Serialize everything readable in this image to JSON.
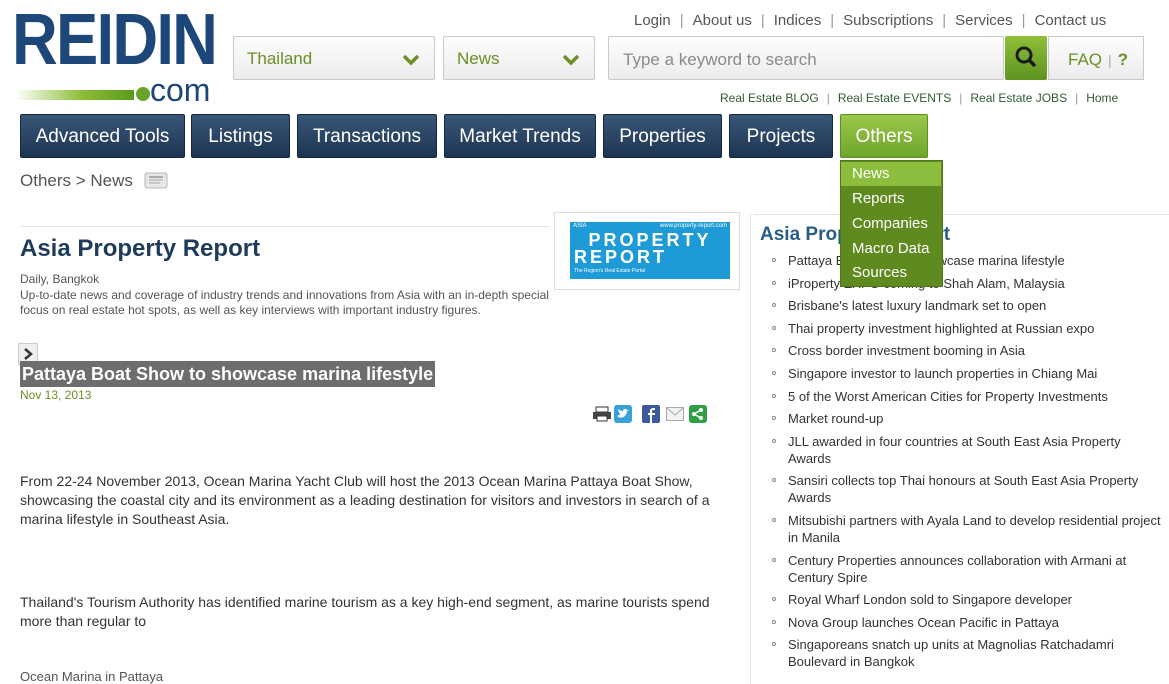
{
  "logo": {
    "word": "REIDIN",
    "suffix": "com"
  },
  "top_links": [
    "Login",
    "About us",
    "Indices",
    "Subscriptions",
    "Services",
    "Contact us"
  ],
  "country_select": {
    "value": "Thailand"
  },
  "section_select": {
    "value": "News"
  },
  "search": {
    "placeholder": "Type a keyword to search"
  },
  "faq": {
    "label": "FAQ",
    "help": "?"
  },
  "small_links": [
    "Real Estate BLOG",
    "Real Estate EVENTS",
    "Real Estate JOBS",
    "Home"
  ],
  "nav": [
    {
      "label": "Advanced Tools"
    },
    {
      "label": "Listings"
    },
    {
      "label": "Transactions"
    },
    {
      "label": "Market Trends"
    },
    {
      "label": "Properties"
    },
    {
      "label": "Projects"
    },
    {
      "label": "Others"
    }
  ],
  "dropdown": [
    "News",
    "Reports",
    "Companies",
    "Macro Data",
    "Sources"
  ],
  "breadcrumb": "Others > News",
  "publication": {
    "title": "Asia Property Report",
    "meta": "Daily, Bangkok",
    "description": "Up-to-date news and coverage of industry trends and innovations from Asia with an in-depth special focus on real estate hot spots, as well as key interviews with important industry figures.",
    "logo_top_left": "ASIA",
    "logo_top_right": "www.property-report.com",
    "logo_line1": "PROPERTY",
    "logo_line2": "REPORT",
    "logo_tagline": "The Region's Real Estate Portal"
  },
  "article": {
    "headline": "Pattaya Boat Show to showcase marina lifestyle",
    "date": "Nov 13, 2013",
    "paragraphs": [
      "From 22-24 November 2013, Ocean Marina Yacht Club will host the 2013 Ocean Marina Pattaya Boat Show, showcasing the coastal city and its environment as a leading destination for visitors and investors in search of a marina lifestyle in Southeast Asia.",
      "Thailand's Tourism Authority has identified marine tourism as a key high-end segment, as marine tourists spend more than regular to",
      "Ocean Marina in Pattaya"
    ]
  },
  "sidebar": {
    "title": "Asia Property Report",
    "items": [
      "Pattaya Boat Show to showcase marina lifestyle",
      "iProperty EXPO coming to Shah Alam, Malaysia",
      "Brisbane's latest luxury landmark set to open",
      "Thai property investment highlighted at Russian expo",
      "Cross border investment booming in Asia",
      "Singapore investor to launch properties in Chiang Mai",
      "5 of the Worst American Cities for Property Investments",
      "Market round-up",
      "JLL awarded in four countries at South East Asia Property Awards",
      "Sansiri collects top Thai honours at South East Asia Property Awards",
      "Mitsubishi partners with Ayala Land to develop residential project in Manila",
      "Century Properties announces collaboration with Armani at Century Spire",
      "Royal Wharf London sold to Singapore developer",
      "Nova Group launches Ocean Pacific in Pattaya",
      "Singaporeans snatch up units at Magnolias Ratchadamri Boulevard in Bangkok"
    ]
  },
  "colors": {
    "brand_blue": "#1d4778",
    "brand_green": "#6da52c",
    "nav_dark": "#1d3552"
  }
}
